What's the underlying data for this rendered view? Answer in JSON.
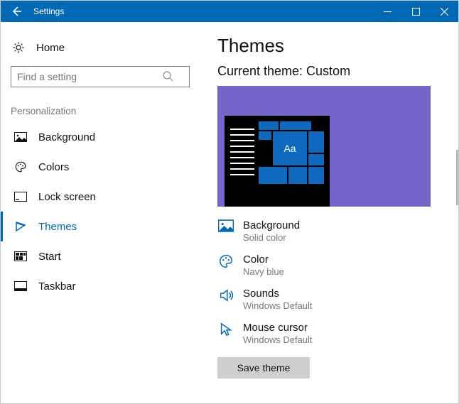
{
  "titlebar": {
    "title": "Settings"
  },
  "sidebar": {
    "home_label": "Home",
    "search_placeholder": "Find a setting",
    "section_label": "Personalization",
    "items": [
      {
        "label": "Background",
        "icon": "picture-icon",
        "active": false
      },
      {
        "label": "Colors",
        "icon": "palette-icon",
        "active": false
      },
      {
        "label": "Lock screen",
        "icon": "lockscreen-icon",
        "active": false
      },
      {
        "label": "Themes",
        "icon": "themes-icon",
        "active": true
      },
      {
        "label": "Start",
        "icon": "start-icon",
        "active": false
      },
      {
        "label": "Taskbar",
        "icon": "taskbar-icon",
        "active": false
      }
    ]
  },
  "main": {
    "heading": "Themes",
    "current_theme_label": "Current theme: Custom",
    "preview": {
      "accent": "#0f6abf",
      "bg": "#7565c9",
      "tile_text": "Aa"
    },
    "options": [
      {
        "title": "Background",
        "subtitle": "Solid color"
      },
      {
        "title": "Color",
        "subtitle": "Navy blue"
      },
      {
        "title": "Sounds",
        "subtitle": "Windows Default"
      },
      {
        "title": "Mouse cursor",
        "subtitle": "Windows Default"
      }
    ],
    "save_button_label": "Save theme"
  }
}
